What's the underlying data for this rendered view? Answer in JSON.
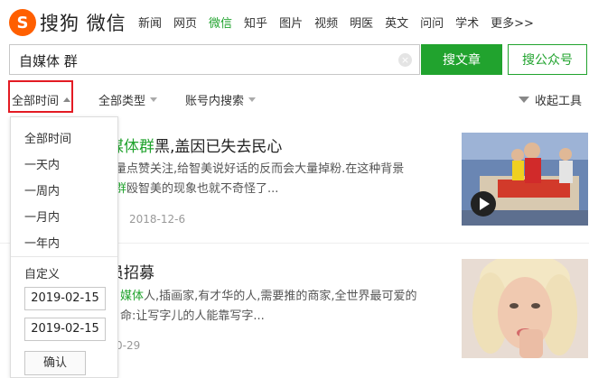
{
  "header": {
    "logo_text": "搜狗",
    "logo_sub": "微信",
    "nav": [
      {
        "label": "新闻",
        "active": false
      },
      {
        "label": "网页",
        "active": false
      },
      {
        "label": "微信",
        "active": true
      },
      {
        "label": "知乎",
        "active": false
      },
      {
        "label": "图片",
        "active": false
      },
      {
        "label": "视频",
        "active": false
      },
      {
        "label": "明医",
        "active": false
      },
      {
        "label": "英文",
        "active": false
      },
      {
        "label": "问问",
        "active": false
      },
      {
        "label": "学术",
        "active": false
      },
      {
        "label": "更多>>",
        "active": false
      }
    ]
  },
  "search": {
    "query": "自媒体 群",
    "clear_icon": "×",
    "article_button": "搜文章",
    "account_button": "搜公众号"
  },
  "filters": {
    "time": "全部时间",
    "type": "全部类型",
    "account": "账号内搜索",
    "collapse": "收起工具"
  },
  "time_dropdown": {
    "options": [
      "全部时间",
      "一天内",
      "一周内",
      "一月内",
      "一年内"
    ],
    "custom_label": "自定义",
    "date_from": "2019-02-15",
    "date_to": "2019-02-15",
    "confirm": "确认"
  },
  "results": [
    {
      "title_hl": "媒体群",
      "title_rest": "黑,盖因已失去民心",
      "desc_line1": "量点赞关注,给智美说好话的反而会大量掉粉.在这种背景",
      "desc_hl": "群",
      "desc_line2": "殴智美的现象也就不奇怪了...",
      "date": "2018-12-6"
    },
    {
      "title_rest": "员招募",
      "desc_hl": "媒体",
      "desc_line1": "人,插画家,有才华的人,需要推的商家,全世界最可爱的",
      "desc_line2": "命:让写字儿的人能靠写字...",
      "date": "0-29"
    }
  ]
}
